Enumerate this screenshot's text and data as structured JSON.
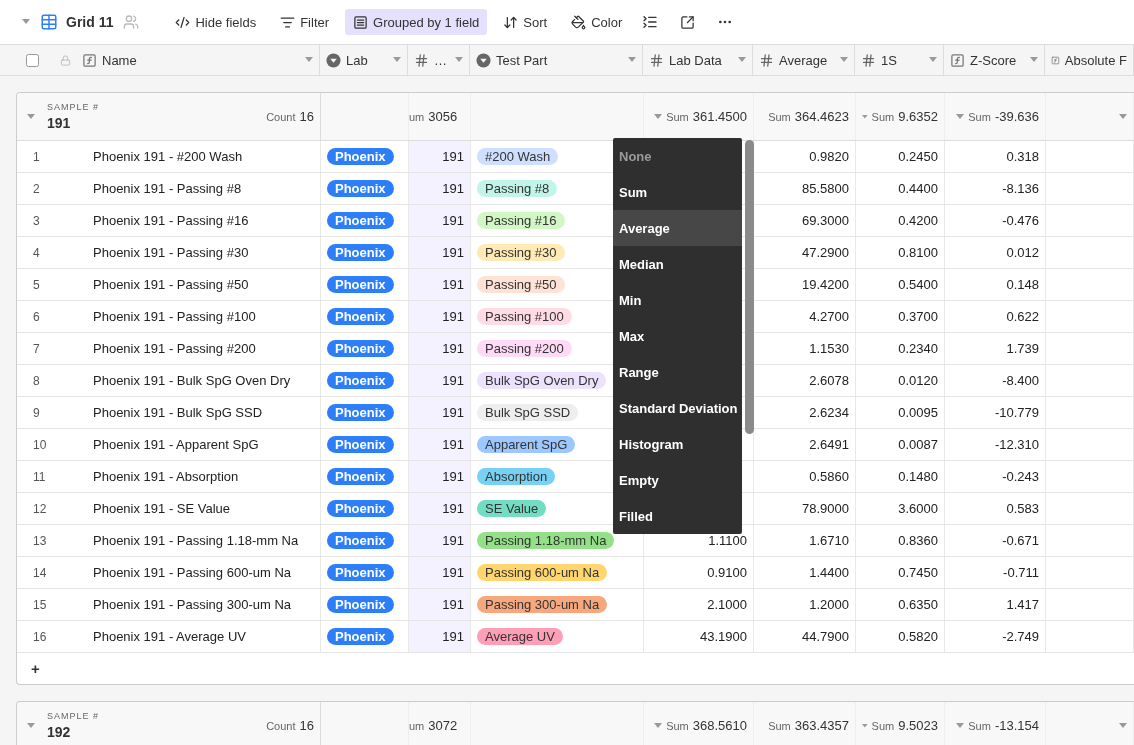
{
  "view": {
    "name": "Grid 11"
  },
  "toolbar": [
    {
      "label": "Hide fields",
      "kind": "hide",
      "selected": false
    },
    {
      "label": "Filter",
      "kind": "filter",
      "selected": false
    },
    {
      "label": "Grouped by 1 field",
      "kind": "group",
      "selected": true
    },
    {
      "label": "Sort",
      "kind": "sort",
      "selected": false
    },
    {
      "label": "Color",
      "kind": "color",
      "selected": false
    }
  ],
  "columns": [
    {
      "label": "Name",
      "kind": "formula"
    },
    {
      "label": "Lab",
      "kind": "select"
    },
    {
      "label": "…",
      "kind": "number"
    },
    {
      "label": "Test Part",
      "kind": "select"
    },
    {
      "label": "Lab Data",
      "kind": "number"
    },
    {
      "label": "Average",
      "kind": "number"
    },
    {
      "label": "1S",
      "kind": "number"
    },
    {
      "label": "Z-Score",
      "kind": "formula"
    },
    {
      "label": "Absolute F",
      "kind": "formula"
    }
  ],
  "groups": [
    {
      "field_label": "SAMPLE #",
      "value": "191",
      "count_label": "Count",
      "count": "16",
      "summaries": [
        {
          "label": "um",
          "value": "3056",
          "caret": false
        },
        {
          "label": "Sum",
          "value": "361.4500",
          "caret": true
        },
        {
          "label": "Sum",
          "value": "364.4623",
          "caret": false
        },
        {
          "label": "Sum",
          "value": "9.6352",
          "caret": true
        },
        {
          "label": "Sum",
          "value": "-39.636",
          "caret": true
        }
      ],
      "rows": [
        {
          "number": "1",
          "name": "Phoenix 191 - #200 Wash",
          "lab": "Phoenix",
          "sample": "191",
          "test_part": {
            "label": "#200 Wash",
            "color": "#cfdfff"
          },
          "average": "0.9820",
          "s1": "0.2450",
          "z_score": "0.318"
        },
        {
          "number": "2",
          "name": "Phoenix 191 - Passing #8",
          "lab": "Phoenix",
          "sample": "191",
          "test_part": {
            "label": "Passing #8",
            "color": "#c2f5e9"
          },
          "average": "85.5800",
          "s1": "0.4400",
          "z_score": "-8.136"
        },
        {
          "number": "3",
          "name": "Phoenix 191 - Passing #16",
          "lab": "Phoenix",
          "sample": "191",
          "test_part": {
            "label": "Passing #16",
            "color": "#d1f7c4"
          },
          "average": "69.3000",
          "s1": "0.4200",
          "z_score": "-0.476"
        },
        {
          "number": "4",
          "name": "Phoenix 191 - Passing #30",
          "lab": "Phoenix",
          "sample": "191",
          "test_part": {
            "label": "Passing #30",
            "color": "#ffeab6"
          },
          "average": "47.2900",
          "s1": "0.8100",
          "z_score": "0.012"
        },
        {
          "number": "5",
          "name": "Phoenix 191 - Passing #50",
          "lab": "Phoenix",
          "sample": "191",
          "test_part": {
            "label": "Passing #50",
            "color": "#fee2d5"
          },
          "average": "19.4200",
          "s1": "0.5400",
          "z_score": "0.148"
        },
        {
          "number": "6",
          "name": "Phoenix 191 - Passing #100",
          "lab": "Phoenix",
          "sample": "191",
          "test_part": {
            "label": "Passing #100",
            "color": "#ffdce5"
          },
          "average": "4.2700",
          "s1": "0.3700",
          "z_score": "0.622"
        },
        {
          "number": "7",
          "name": "Phoenix 191 - Passing #200",
          "lab": "Phoenix",
          "sample": "191",
          "test_part": {
            "label": "Passing #200",
            "color": "#ffdaf6"
          },
          "average": "1.1530",
          "s1": "0.2340",
          "z_score": "1.739"
        },
        {
          "number": "8",
          "name": "Phoenix 191 - Bulk SpG Oven Dry",
          "lab": "Phoenix",
          "sample": "191",
          "test_part": {
            "label": "Bulk SpG Oven Dry",
            "color": "#ede2fe"
          },
          "average": "2.6078",
          "s1": "0.0120",
          "z_score": "-8.400"
        },
        {
          "number": "9",
          "name": "Phoenix 191 - Bulk SpG SSD",
          "lab": "Phoenix",
          "sample": "191",
          "test_part": {
            "label": "Bulk SpG SSD",
            "color": "#eeeeee"
          },
          "average": "2.6234",
          "s1": "0.0095",
          "z_score": "-10.779"
        },
        {
          "number": "10",
          "name": "Phoenix 191 - Apparent SpG",
          "lab": "Phoenix",
          "sample": "191",
          "test_part": {
            "label": "Apparent SpG",
            "color": "#9cc7ff"
          },
          "average": "2.6491",
          "s1": "0.0087",
          "z_score": "-12.310"
        },
        {
          "number": "11",
          "name": "Phoenix 191 - Absorption",
          "lab": "Phoenix",
          "sample": "191",
          "test_part": {
            "label": "Absorption",
            "color": "#77d1f3"
          },
          "average": "0.5860",
          "s1": "0.1480",
          "z_score": "-0.243"
        },
        {
          "number": "12",
          "name": "Phoenix 191 - SE Value",
          "lab": "Phoenix",
          "sample": "191",
          "test_part": {
            "label": "SE Value",
            "color": "#72ddc3"
          },
          "average": "78.9000",
          "s1": "3.6000",
          "z_score": "0.583"
        },
        {
          "number": "13",
          "name": "Phoenix 191 - Passing 1.18-mm Na",
          "lab": "Phoenix",
          "sample": "191",
          "test_part": {
            "label": "Passing 1.18-mm Na",
            "color": "#93e088"
          },
          "lab_data": "1.1100",
          "average": "1.6710",
          "s1": "0.8360",
          "z_score": "-0.671"
        },
        {
          "number": "14",
          "name": "Phoenix 191 - Passing 600-um Na",
          "lab": "Phoenix",
          "sample": "191",
          "test_part": {
            "label": "Passing 600-um Na",
            "color": "#ffd66e"
          },
          "lab_data": "0.9100",
          "average": "1.4400",
          "s1": "0.7450",
          "z_score": "-0.711"
        },
        {
          "number": "15",
          "name": "Phoenix 191 - Passing 300-um Na",
          "lab": "Phoenix",
          "sample": "191",
          "test_part": {
            "label": "Passing 300-um Na",
            "color": "#f7a77e"
          },
          "lab_data": "2.1000",
          "average": "1.2000",
          "s1": "0.6350",
          "z_score": "1.417"
        },
        {
          "number": "16",
          "name": "Phoenix 191 - Average UV",
          "lab": "Phoenix",
          "sample": "191",
          "test_part": {
            "label": "Average UV",
            "color": "#ff9eb7"
          },
          "lab_data": "43.1900",
          "average": "44.7900",
          "s1": "0.5820",
          "z_score": "-2.749"
        }
      ],
      "add_row": "+"
    },
    {
      "field_label": "SAMPLE #",
      "value": "192",
      "count_label": "Count",
      "count": "16",
      "summaries": [
        {
          "label": "um",
          "value": "3072",
          "caret": false
        },
        {
          "label": "Sum",
          "value": "368.5610",
          "caret": true
        },
        {
          "label": "Sum",
          "value": "363.4357",
          "caret": false
        },
        {
          "label": "Sum",
          "value": "9.5023",
          "caret": true
        },
        {
          "label": "Sum",
          "value": "-13.154",
          "caret": true
        }
      ]
    }
  ],
  "select_all": {
    "checked": false
  },
  "summary_menu": {
    "items": [
      {
        "label": "None",
        "selected": false,
        "disabled": true
      },
      {
        "label": "Sum",
        "selected": false,
        "disabled": false
      },
      {
        "label": "Average",
        "selected": true,
        "disabled": false
      },
      {
        "label": "Median",
        "selected": false,
        "disabled": false
      },
      {
        "label": "Min",
        "selected": false,
        "disabled": false
      },
      {
        "label": "Max",
        "selected": false,
        "disabled": false
      },
      {
        "label": "Range",
        "selected": false,
        "disabled": false
      },
      {
        "label": "Standard Deviation",
        "selected": false,
        "disabled": false
      },
      {
        "label": "Histogram",
        "selected": false,
        "disabled": false
      },
      {
        "label": "Empty",
        "selected": false,
        "disabled": false
      },
      {
        "label": "Filled",
        "selected": false,
        "disabled": false
      }
    ]
  }
}
